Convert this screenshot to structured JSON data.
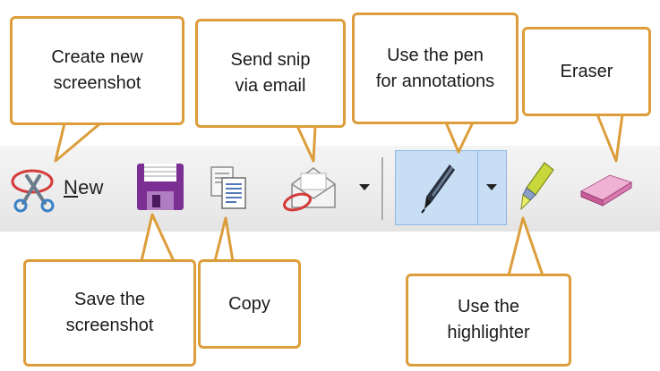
{
  "toolbar": {
    "new_label_mnemonic": "N",
    "new_label_rest": "ew"
  },
  "callouts": {
    "create_new": "Create new\nscreenshot",
    "send_snip": "Send snip\nvia email",
    "use_pen": "Use the pen\nfor annotations",
    "eraser": "Eraser",
    "save": "Save the\nscreenshot",
    "copy": "Copy",
    "highlighter": "Use the\nhighlighter"
  },
  "colors": {
    "callout_border": "#dc9d3a",
    "pen_selected_bg": "#c7def5",
    "save_icon": "#7b2f93",
    "eraser_icon": "#d97ab1",
    "highlighter_icon": "#c8d83a"
  }
}
